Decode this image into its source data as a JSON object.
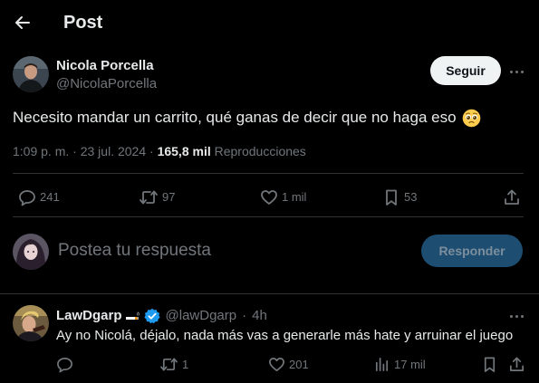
{
  "header": {
    "title": "Post",
    "back_icon": "arrow-left-icon"
  },
  "post": {
    "author_name": "Nicola Porcella",
    "author_handle": "@NicolaPorcella",
    "follow_label": "Seguir",
    "text": "Necesito mandar un carrito, qué ganas de decir que no haga eso",
    "text_emoji": "pleading-face",
    "time": "1:09 p. m.",
    "date_sep": " · ",
    "date": "23 jul. 2024",
    "views_sep": " · ",
    "views_count": "165,8 mil",
    "views_label": "Reproducciones",
    "stats": {
      "replies": "241",
      "reposts": "97",
      "likes": "1 mil",
      "bookmarks": "53"
    }
  },
  "composer": {
    "placeholder": "Postea tu respuesta",
    "submit_label": "Responder"
  },
  "reply": {
    "author_name": "LawDgarp",
    "author_handle": "@lawDgarp",
    "time_sep": "·",
    "time": "4h",
    "text": "Ay no Nicolá, déjalo, nada más vas a generarle más hate y arruinar el juego",
    "stats": {
      "replies": "",
      "reposts": "1",
      "likes": "201",
      "views": "17 mil"
    }
  },
  "colors": {
    "background": "#000000",
    "text": "#e7e9ea",
    "muted": "#71767b",
    "divider": "#2f3336",
    "follow_bg": "#eff3f4",
    "reply_button_bg": "#1d4e72",
    "verified": "#1d9bf0"
  }
}
